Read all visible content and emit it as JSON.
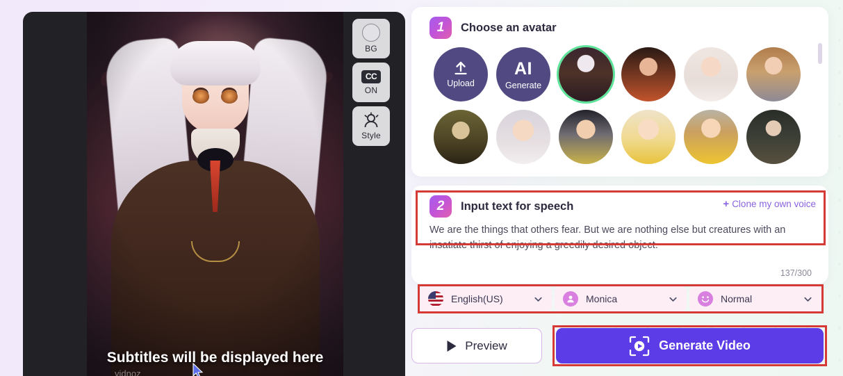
{
  "app": {
    "background_left": "#f2e9fa",
    "background_right": "#eef8f2"
  },
  "video_preview": {
    "name": "avatar-video-preview",
    "subtitle_text": "Subtitles will be displayed here",
    "watermark": "vidnoz",
    "controls": [
      {
        "id": "bg",
        "icon": "circle-icon",
        "label": "BG",
        "top_text": ""
      },
      {
        "id": "cc",
        "icon": "cc-icon",
        "label": "ON",
        "top_text": "CC"
      },
      {
        "id": "style",
        "icon": "person-style-icon",
        "label": "Style",
        "top_text": ""
      }
    ]
  },
  "avatar_section": {
    "step_number": "1",
    "title": "Choose an avatar",
    "accent": "#a45cf0",
    "selected_index": 2,
    "selection_color": "#5de49a",
    "avatars": [
      {
        "name": "upload",
        "type": "action",
        "label": "Upload",
        "icon": "upload-arrow-icon"
      },
      {
        "name": "ai-generate",
        "type": "action",
        "label": "Generate",
        "icon": "ai-text-icon",
        "top": "AI"
      },
      {
        "name": "anime-girl",
        "type": "photo",
        "label": ""
      },
      {
        "name": "woman-orange-dress",
        "type": "photo",
        "label": ""
      },
      {
        "name": "cartoon-man-white-shirt",
        "type": "photo",
        "label": ""
      },
      {
        "name": "woman-long-blonde-hair",
        "type": "photo",
        "label": ""
      },
      {
        "name": "mona-lisa",
        "type": "photo",
        "label": ""
      },
      {
        "name": "cartoon-woman-bun",
        "type": "photo",
        "label": ""
      },
      {
        "name": "cartoon-boy-dark-hair",
        "type": "photo",
        "label": ""
      },
      {
        "name": "cartoon-girl-yellow",
        "type": "photo",
        "label": ""
      },
      {
        "name": "cartoon-boy-yellow-hoodie",
        "type": "photo",
        "label": ""
      },
      {
        "name": "einstein",
        "type": "photo",
        "label": ""
      }
    ]
  },
  "speech_section": {
    "step_number": "2",
    "title": "Input text for speech",
    "clone_link": "Clone my own voice",
    "clone_plus": "+",
    "text_value": "We are the things that others fear. But we are nothing else but creatures with an insatiate thirst of enjoying a greedily desired object.",
    "char_count": "137/300"
  },
  "voice_settings": {
    "language": {
      "value": "English(US)",
      "icon": "us-flag-icon"
    },
    "voice": {
      "value": "Monica",
      "icon": "person-avatar-icon"
    },
    "style": {
      "value": "Normal",
      "icon": "smiley-icon"
    }
  },
  "actions": {
    "preview_label": "Preview",
    "preview_icon": "play-icon",
    "generate_label": "Generate Video",
    "generate_icon": "video-capture-icon",
    "generate_color": "#5b3ce6"
  },
  "annotations": {
    "color": "#d63a36",
    "boxes": [
      "speech-input",
      "voice-settings-row",
      "generate-video-button"
    ]
  }
}
